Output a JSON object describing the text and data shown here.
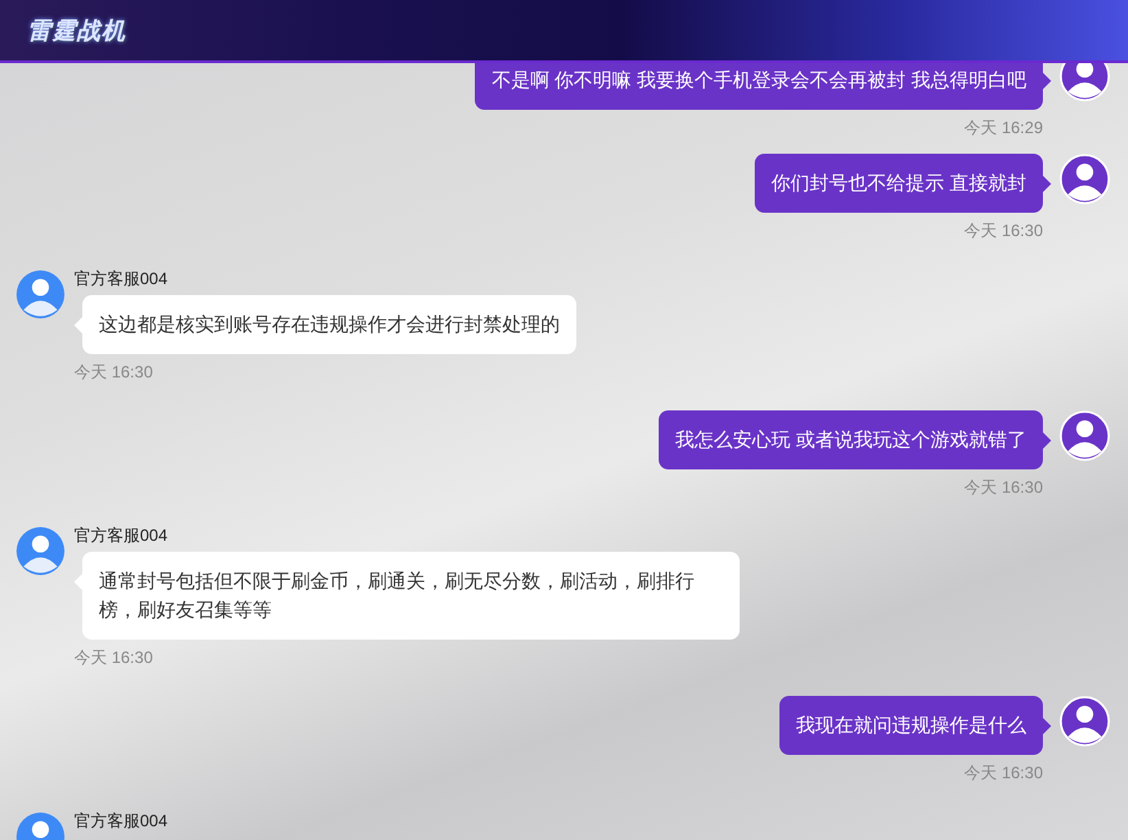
{
  "header": {
    "logo": "雷霆战机"
  },
  "messages": [
    {
      "kind": "outgoing",
      "text": "不是啊 你不明嘛 我要换个手机登录会不会再被封 我总得明白吧",
      "time": "今天 16:29"
    },
    {
      "kind": "outgoing",
      "text": "你们封号也不给提示 直接就封",
      "time": "今天 16:30"
    },
    {
      "kind": "incoming",
      "sender": "官方客服004",
      "text": "这边都是核实到账号存在违规操作才会进行封禁处理的",
      "time": "今天 16:30"
    },
    {
      "kind": "outgoing",
      "text": "我怎么安心玩 或者说我玩这个游戏就错了",
      "time": "今天 16:30"
    },
    {
      "kind": "incoming",
      "sender": "官方客服004",
      "text": "通常封号包括但不限于刷金币，刷通关，刷无尽分数，刷活动，刷排行榜，刷好友召集等等",
      "time": "今天 16:30"
    },
    {
      "kind": "outgoing",
      "text": "我现在就问违规操作是什么",
      "time": "今天 16:30"
    },
    {
      "kind": "incoming",
      "sender": "官方客服004"
    }
  ]
}
